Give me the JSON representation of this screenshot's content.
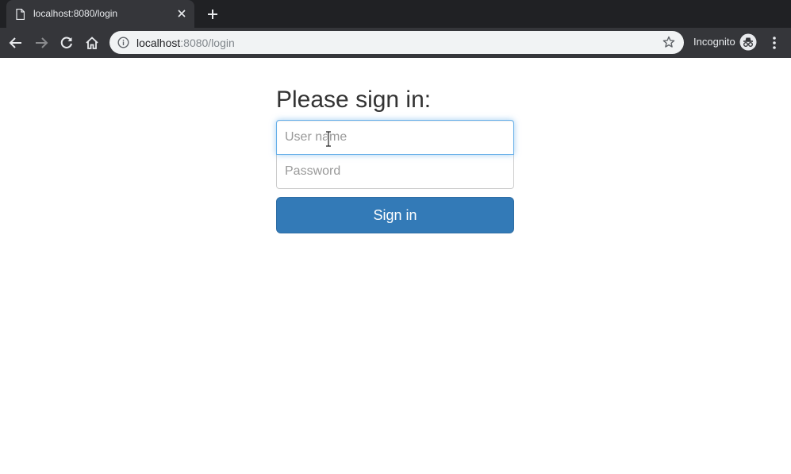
{
  "browser": {
    "tab": {
      "title": "localhost:8080/login"
    },
    "address_bar": {
      "host": "localhost",
      "path": ":8080/login"
    },
    "incognito_label": "Incognito",
    "icons": {
      "favicon": "page-icon",
      "close": "close-icon",
      "new_tab": "plus-icon",
      "back": "arrow-left-icon",
      "forward": "arrow-right-icon",
      "reload": "reload-icon",
      "home": "home-icon",
      "site_info": "info-icon",
      "bookmark": "star-icon",
      "incognito": "incognito-icon",
      "menu": "kebab-menu-icon"
    }
  },
  "login": {
    "heading": "Please sign in:",
    "username_placeholder": "User name",
    "username_value": "",
    "password_placeholder": "Password",
    "password_value": "",
    "submit_label": "Sign in"
  },
  "colors": {
    "primary_button": "#337ab7",
    "focus_border": "#66afe9",
    "chrome_dark": "#202124",
    "chrome_toolbar": "#35363a"
  }
}
